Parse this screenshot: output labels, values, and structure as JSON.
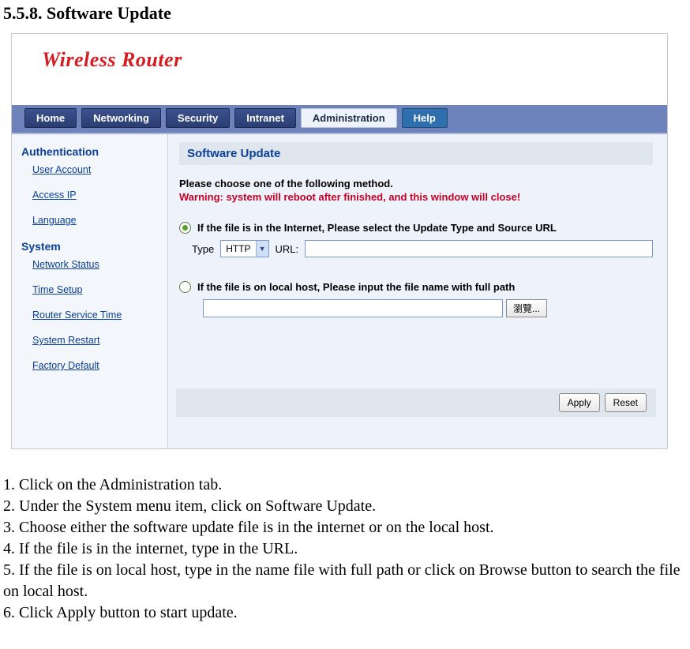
{
  "section_heading": "5.5.8. Software Update",
  "banner_title": "Wireless Router",
  "nav": {
    "home": "Home",
    "networking": "Networking",
    "security": "Security",
    "intranet": "Intranet",
    "administration": "Administration",
    "help": "Help"
  },
  "sidebar": {
    "auth_head": "Authentication",
    "user_account": "User Account",
    "access_ip": "Access IP",
    "language": "Language",
    "system_head": "System",
    "network_status": "Network Status",
    "time_setup": "Time Setup",
    "router_service_time": "Router Service Time",
    "system_restart": "System Restart",
    "factory_default": "Factory Default"
  },
  "panel": {
    "title": "Software Update",
    "instr": "Please choose one of the following method.",
    "warn": "Warning: system will reboot after finished, and this window will close!",
    "opt1_label": "If the file is in the Internet, Please select the Update Type and Source URL",
    "type_label": "Type",
    "type_value": "HTTP",
    "url_label": "URL:",
    "url_value": "",
    "opt2_label": "If the file is on local host, Please input the file name with full path",
    "file_value": "",
    "browse": "瀏覽...",
    "apply": "Apply",
    "reset": "Reset"
  },
  "steps": {
    "s1": "1. Click on the Administration tab.",
    "s2": "2. Under the System menu item, click on Software Update.",
    "s3": "3. Choose either the software update file is in the internet or on the local host.",
    "s4": "4. If the file is in the internet, type in the URL.",
    "s5": "5. If the file is on local host, type in the name file with full path or click on Browse button to search the file on local host.",
    "s6": "6. Click Apply button to start update."
  }
}
